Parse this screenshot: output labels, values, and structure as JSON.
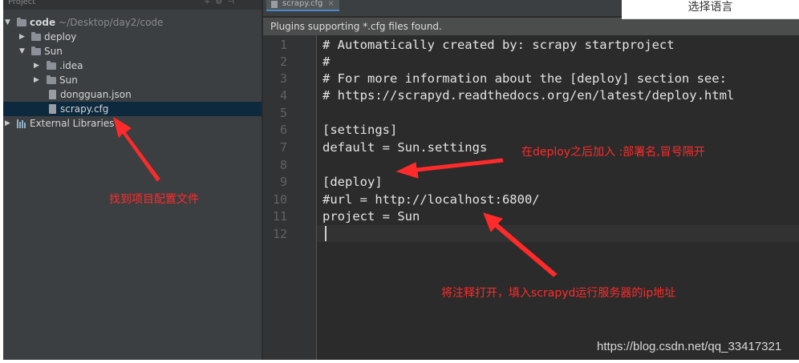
{
  "project_panel": {
    "header_label": "Project",
    "tree": [
      {
        "label": "code",
        "path": "~/Desktop/day2/code",
        "expanded": true,
        "icon": "folder-icon"
      },
      {
        "label": "deploy",
        "expanded": false,
        "icon": "folder-icon"
      },
      {
        "label": "Sun",
        "expanded": true,
        "icon": "folder-icon"
      },
      {
        "label": ".idea",
        "expanded": false,
        "icon": "folder-icon"
      },
      {
        "label": "Sun",
        "expanded": false,
        "icon": "folder-icon"
      },
      {
        "label": "dongguan.json",
        "icon": "file-icon"
      },
      {
        "label": "scrapy.cfg",
        "icon": "file-icon",
        "selected": true
      },
      {
        "label": "External Libraries",
        "expanded": false,
        "icon": "library-icon"
      }
    ]
  },
  "editor": {
    "tab_label": "scrapy.cfg",
    "banner": "Plugins supporting *.cfg files found.",
    "lines": [
      {
        "n": "1",
        "text": "# Automatically created by: scrapy startproject"
      },
      {
        "n": "2",
        "text": "#"
      },
      {
        "n": "3",
        "text": "# For more information about the [deploy] section see:"
      },
      {
        "n": "4",
        "text": "# https://scrapyd.readthedocs.org/en/latest/deploy.html"
      },
      {
        "n": "5",
        "text": ""
      },
      {
        "n": "6",
        "text": "[settings]"
      },
      {
        "n": "7",
        "text": "default = Sun.settings"
      },
      {
        "n": "8",
        "text": ""
      },
      {
        "n": "9",
        "text": "[deploy]"
      },
      {
        "n": "10",
        "text": "#url = http://localhost:6800/"
      },
      {
        "n": "11",
        "text": "project = Sun"
      },
      {
        "n": "12",
        "text": ""
      }
    ]
  },
  "language_button": "选择语言",
  "annotations": {
    "left": "找到项目配置文件",
    "top_right": "在deploy之后加入 :部署名,冒号隔开",
    "bottom": "将注释打开，填入scrapyd运行服务器的ip地址",
    "color": "#ff2a2a"
  },
  "watermark": "https://blog.csdn.net/qq_33417321"
}
